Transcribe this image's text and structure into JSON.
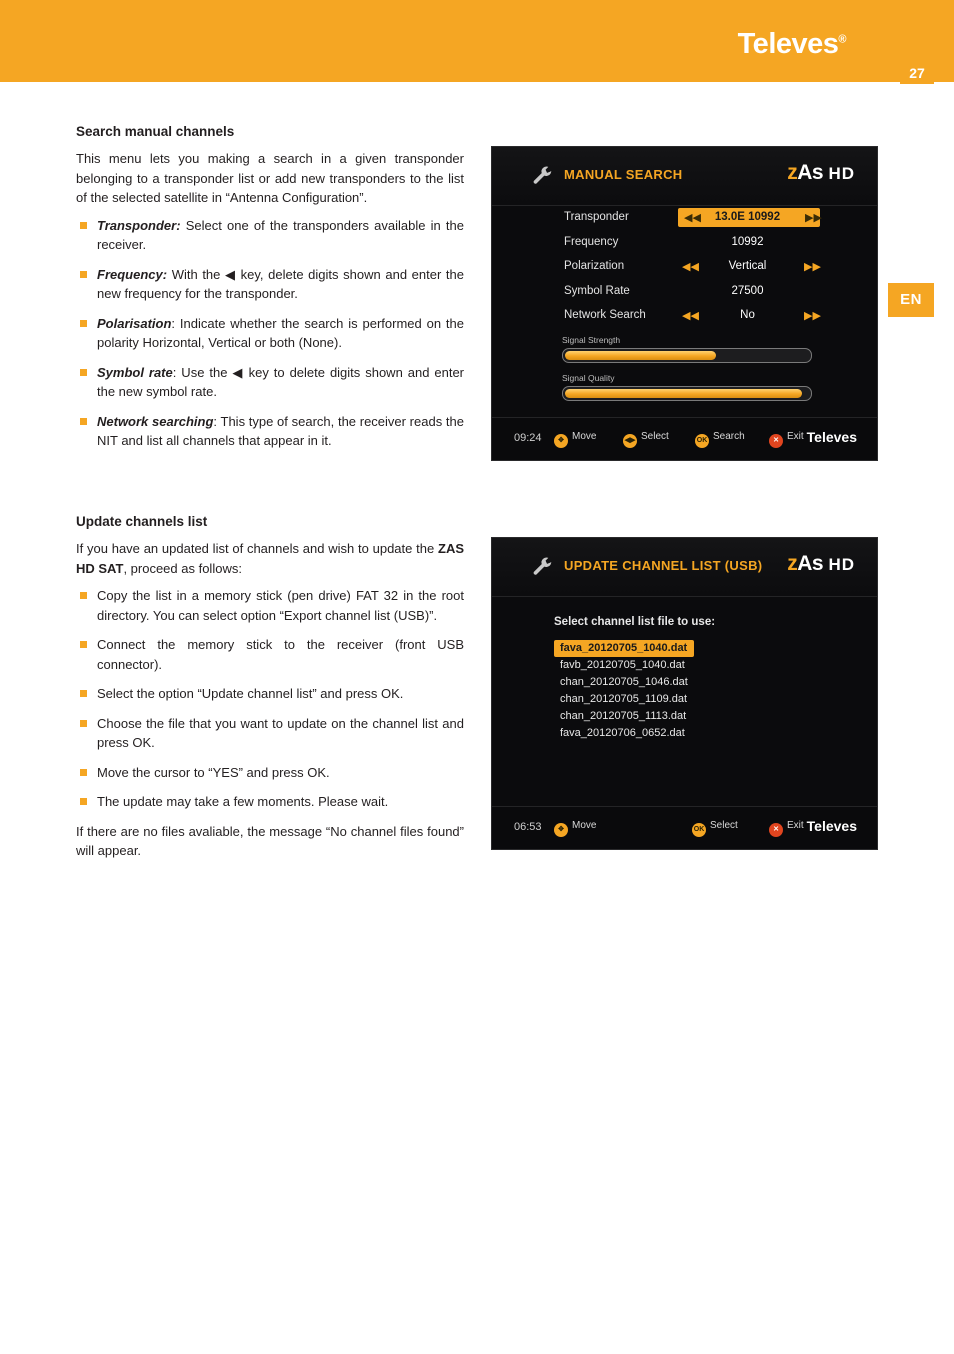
{
  "header": {
    "brand": "Televes",
    "brand_sup": "®",
    "page_number": "27",
    "lang_badge": "EN"
  },
  "section1": {
    "title": "Search manual channels",
    "intro": "This menu lets you making a search in a given transponder belonging to a transponder list or add new transponders to the list of the selected satellite in “Antenna Configuration”.",
    "bullets": [
      {
        "term": "Transponder:",
        "text": " Select one of the transponders available in the receiver."
      },
      {
        "term": "Frequency:",
        "text": "  With the ◀ key, delete digits shown and enter the new frequency for the transponder."
      },
      {
        "term": "Polarisation",
        "text": ": Indicate whether the search is performed on the polarity Horizontal, Vertical or both (None)."
      },
      {
        "term": "Symbol rate",
        "text": ": Use the ◀ key to delete digits shown and enter the new symbol rate."
      },
      {
        "term": "Network searching",
        "text": ": This type of search, the receiver reads the NIT and list all channels that appear in it."
      }
    ]
  },
  "section2": {
    "title": "Update channels list",
    "intro_a": "If you have an updated list of channels and wish to update the ",
    "intro_bold": "ZAS HD SAT",
    "intro_b": ", proceed as follows:",
    "bullets": [
      "Copy the list in a memory stick (pen drive) FAT 32 in the root directory. You can select option “Export channel list (USB)”.",
      "Connect the memory stick to the receiver (front USB connector).",
      "Select the option “Update channel list” and press OK.",
      "Choose the file that you want to update on the channel list and press OK.",
      "Move the cursor to “YES” and press OK.",
      "The update may take a few moments. Please wait."
    ],
    "outro": "If there are no files avaliable, the message “No channel files found” will appear."
  },
  "tv1": {
    "title": "MANUAL SEARCH",
    "logo_z": "z",
    "logo_as": "As",
    "logo_hd": "HD",
    "rows": [
      {
        "label": "Transponder",
        "value": "13.0E 10992",
        "selected": true,
        "arrows": true
      },
      {
        "label": "Frequency",
        "value": "10992",
        "selected": false,
        "arrows": false
      },
      {
        "label": "Polarization",
        "value": "Vertical",
        "selected": false,
        "arrows": true
      },
      {
        "label": "Symbol Rate",
        "value": "27500",
        "selected": false,
        "arrows": false
      },
      {
        "label": "Network Search",
        "value": "No",
        "selected": false,
        "arrows": true
      }
    ],
    "bars": [
      {
        "label": "Signal Strength",
        "percent": 62
      },
      {
        "label": "Signal Quality",
        "percent": 97
      }
    ],
    "clock": "09:24",
    "hints": [
      {
        "icon": "nav-icon",
        "label": "Move"
      },
      {
        "icon": "lr-icon",
        "label": "Select"
      },
      {
        "icon": "ok-icon",
        "label": "Search"
      },
      {
        "icon": "exit-icon",
        "label": "Exit"
      }
    ],
    "tele": "Televes"
  },
  "tv2": {
    "title": "UPDATE CHANNEL LIST (USB)",
    "logo_z": "z",
    "logo_as": "As",
    "logo_hd": "HD",
    "prompt": "Select channel list file to use:",
    "files": [
      {
        "name": "fava_20120705_1040.dat",
        "selected": true
      },
      {
        "name": "favb_20120705_1040.dat",
        "selected": false
      },
      {
        "name": "chan_20120705_1046.dat",
        "selected": false
      },
      {
        "name": "chan_20120705_1109.dat",
        "selected": false
      },
      {
        "name": "chan_20120705_1113.dat",
        "selected": false
      },
      {
        "name": "fava_20120706_0652.dat",
        "selected": false
      }
    ],
    "clock": "06:53",
    "hints": [
      {
        "icon": "nav-icon",
        "label": "Move"
      },
      {
        "icon": "ok-icon",
        "label": "Select"
      },
      {
        "icon": "exit-icon",
        "label": "Exit"
      }
    ],
    "tele": "Televes"
  },
  "colors": {
    "accent": "#f5a623",
    "screen_bg": "#0b0b0d",
    "exit": "#e1451f"
  }
}
